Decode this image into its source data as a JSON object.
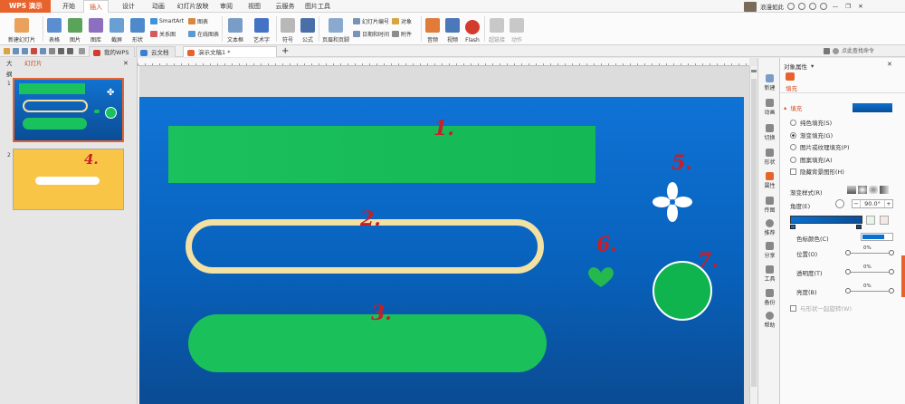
{
  "app": {
    "name": "WPS 演示",
    "menu_tabs": [
      "开始",
      "插入",
      "设计",
      "动画",
      "幻灯片放映",
      "审阅",
      "视图",
      "云服务",
      "图片工具"
    ],
    "active_tab": "插入",
    "user_label": "浪漫如此"
  },
  "ribbon": {
    "new_slide": "新建幻灯片",
    "table": "表格",
    "picture": "图片",
    "gallery": "图库",
    "screenshot": "截屏",
    "shapes": "形状",
    "smartart": "SmartArt",
    "chart": "图表",
    "relation": "关系图",
    "online_chart": "在线图表",
    "textbox": "文本框",
    "wordart": "艺术字",
    "symbol": "符号",
    "formula": "公式",
    "header_footer": "页眉和页脚",
    "slide_number": "幻灯片编号",
    "datetime": "日期和时间",
    "object": "对象",
    "attachment": "附件",
    "audio": "音频",
    "video": "视频",
    "flash": "Flash",
    "hyperlink": "超链接",
    "action": "动作"
  },
  "doc_tabs": {
    "tab1": "我的WPS",
    "tab2": "云文档",
    "tab3": "演示文稿1 *",
    "plus": "+",
    "search": "点此查找命令"
  },
  "left_pane": {
    "tab_outline": "大纲",
    "tab_slides": "幻灯片",
    "slide1": "1",
    "slide2": "2",
    "slide2_annot": "4."
  },
  "slide_annotations": {
    "a1": "1.",
    "a2": "2.",
    "a3": "3.",
    "a5": "5.",
    "a6": "6.",
    "a7": "7."
  },
  "side_icons": [
    "新建",
    "动画",
    "切换",
    "形状",
    "属性",
    "传图",
    "推荐",
    "分享",
    "工具",
    "备份",
    "帮助"
  ],
  "props": {
    "title": "对象属性",
    "tab_fill": "填充",
    "section_fill": "填充",
    "opt_solid": "纯色填充(S)",
    "opt_gradient": "渐变填充(G)",
    "opt_picture": "图片或纹理填充(P)",
    "opt_pattern": "图案填充(A)",
    "opt_hide_bg": "隐藏背景图形(H)",
    "gradient_style": "渐变样式(R)",
    "angle_label": "角度(E)",
    "angle_value": "90.0°",
    "stop_color": "色标颜色(C)",
    "position": "位置(O)",
    "position_val": "0%",
    "transparency": "透明度(T)",
    "transparency_val": "0%",
    "brightness": "亮度(B)",
    "brightness_val": "0%",
    "rotate_with_shape": "与形状一起旋转(W)"
  },
  "colors": {
    "accent": "#e8622c",
    "slide_blue": "#0862bc",
    "shape_green": "#1ac05a",
    "ring_cream": "#f3e0a3",
    "annot_red": "#c81e28"
  }
}
